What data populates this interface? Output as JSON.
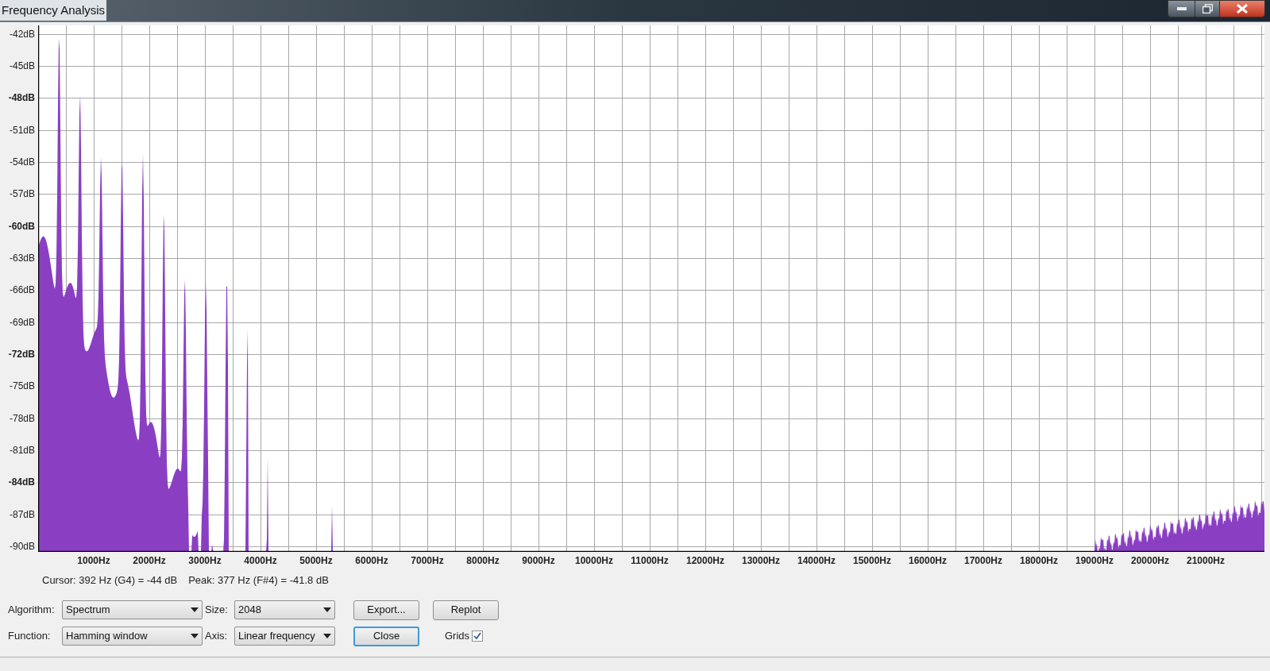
{
  "window": {
    "title": "Frequency Analysis"
  },
  "plot": {
    "y_labels": [
      {
        "text": "-42dB",
        "major": false
      },
      {
        "text": "-45dB",
        "major": false
      },
      {
        "text": "-48dB",
        "major": true
      },
      {
        "text": "-51dB",
        "major": false
      },
      {
        "text": "-54dB",
        "major": false
      },
      {
        "text": "-57dB",
        "major": false
      },
      {
        "text": "-60dB",
        "major": true
      },
      {
        "text": "-63dB",
        "major": false
      },
      {
        "text": "-66dB",
        "major": false
      },
      {
        "text": "-69dB",
        "major": false
      },
      {
        "text": "-72dB",
        "major": true
      },
      {
        "text": "-75dB",
        "major": false
      },
      {
        "text": "-78dB",
        "major": false
      },
      {
        "text": "-81dB",
        "major": false
      },
      {
        "text": "-84dB",
        "major": true
      },
      {
        "text": "-87dB",
        "major": false
      },
      {
        "text": "-90dB",
        "major": false
      }
    ],
    "x_labels": [
      "1000Hz",
      "2000Hz",
      "3000Hz",
      "4000Hz",
      "5000Hz",
      "6000Hz",
      "7000Hz",
      "8000Hz",
      "9000Hz",
      "10000Hz",
      "11000Hz",
      "12000Hz",
      "13000Hz",
      "14000Hz",
      "15000Hz",
      "16000Hz",
      "17000Hz",
      "18000Hz",
      "19000Hz",
      "20000Hz",
      "21000Hz"
    ]
  },
  "readout": {
    "cursor": "Cursor: 392 Hz (G4) = -44 dB",
    "peak": "Peak: 377 Hz (F#4) = -41.8 dB"
  },
  "controls": [
    {
      "label": "Algorithm:",
      "value": "Spectrum"
    },
    {
      "label": "Size:",
      "value": "2048"
    },
    {
      "label": "Function:",
      "value": "Hamming window"
    },
    {
      "label": "Axis:",
      "value": "Linear frequency"
    }
  ],
  "buttons": [
    {
      "label": "Export...",
      "default": false
    },
    {
      "label": "Replot",
      "default": false
    },
    {
      "label": "Close",
      "default": true
    }
  ],
  "grids": {
    "label": "Grids",
    "checked": true
  }
}
